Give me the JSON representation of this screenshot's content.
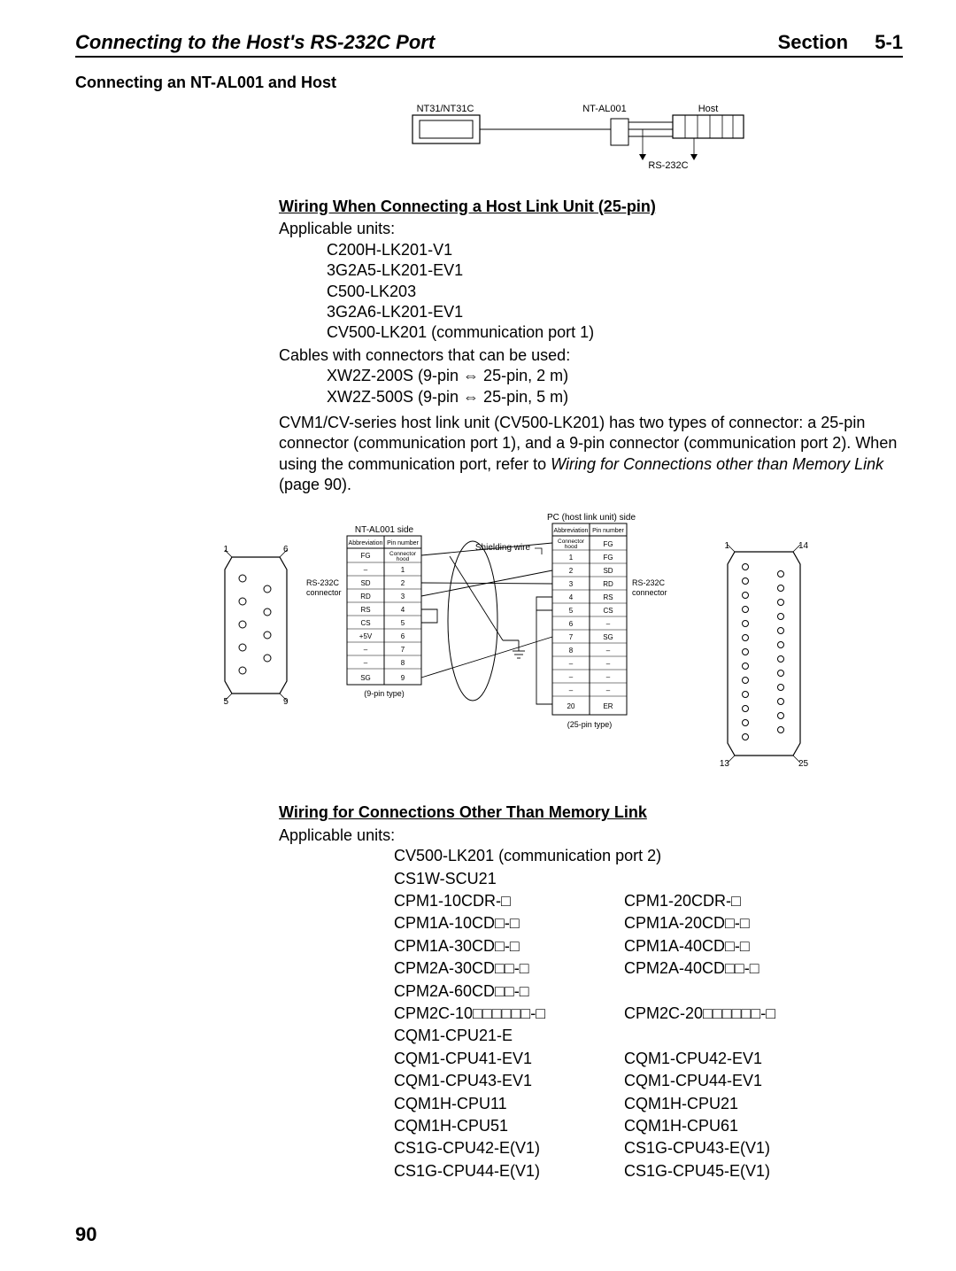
{
  "header": {
    "left": "Connecting to the Host's RS-232C Port",
    "right_label": "Section",
    "right_num": "5-1"
  },
  "sec": {
    "title": "Connecting an NT-AL001 and Host"
  },
  "top_diagram": {
    "left_label": "NT31/NT31C",
    "mid_label": "NT-AL001",
    "right_label": "Host",
    "rs232c_label": "RS-232C"
  },
  "wiring25": {
    "heading": "Wiring When Connecting a Host Link Unit (25-pin)",
    "applicable": "Applicable units:",
    "units": [
      "C200H-LK201-V1",
      "3G2A5-LK201-EV1",
      "C500-LK203",
      "3G2A6-LK201-EV1",
      "CV500-LK201 (communication port 1)"
    ],
    "cables_label": "Cables with connectors that can be used:",
    "cables": [
      "XW2Z-200S (9-pin ⇔ 25-pin, 2 m)",
      "XW2Z-500S (9-pin ⇔ 25-pin, 5 m)"
    ],
    "note": "CVM1/CV-series host link unit (CV500-LK201) has two types of connector: a 25-pin connector (communication port 1), and a 9-pin connector (communication port 2). When using the communication port, refer to ",
    "note_italic": "Wiring for Connections other than Memory Link",
    "note_tail": " (page 90)."
  },
  "wiring_diagram": {
    "nt_side_label": "NT-AL001 side",
    "pc_side_label": "PC (host link unit) side",
    "col_abbrev": "Abbreviation",
    "col_pin": "Pin number",
    "shield_label": "Shielding wire",
    "rs232c_conn": "RS-232C\nconnector",
    "nine_pin_label": "(9-pin type)",
    "twentyfive_pin_label": "(25-pin type)",
    "left_numbers": {
      "tl": "1",
      "tr": "6",
      "bl": "5",
      "br": "9"
    },
    "right_numbers": {
      "tl": "1",
      "tr": "14",
      "bl": "13",
      "br": "25"
    },
    "left_table": [
      {
        "abbr": "FG",
        "pin": "Connector hood"
      },
      {
        "abbr": "–",
        "pin": "1"
      },
      {
        "abbr": "SD",
        "pin": "2"
      },
      {
        "abbr": "RD",
        "pin": "3"
      },
      {
        "abbr": "RS",
        "pin": "4"
      },
      {
        "abbr": "CS",
        "pin": "5"
      },
      {
        "abbr": "+5V",
        "pin": "6"
      },
      {
        "abbr": "–",
        "pin": "7"
      },
      {
        "abbr": "–",
        "pin": "8"
      },
      {
        "abbr": "SG",
        "pin": "9"
      }
    ],
    "right_table": [
      {
        "abbr": "Connector hood",
        "pin": "FG"
      },
      {
        "abbr": "1",
        "pin": "FG"
      },
      {
        "abbr": "2",
        "pin": "SD"
      },
      {
        "abbr": "3",
        "pin": "RD"
      },
      {
        "abbr": "4",
        "pin": "RS"
      },
      {
        "abbr": "5",
        "pin": "CS"
      },
      {
        "abbr": "6",
        "pin": "–"
      },
      {
        "abbr": "7",
        "pin": "SG"
      },
      {
        "abbr": "8",
        "pin": "–"
      },
      {
        "abbr": "–",
        "pin": "–"
      },
      {
        "abbr": "–",
        "pin": "–"
      },
      {
        "abbr": "–",
        "pin": "–"
      },
      {
        "abbr": "20",
        "pin": "ER"
      }
    ]
  },
  "other": {
    "heading": "Wiring for Connections Other Than Memory Link",
    "applicable": "Applicable units:",
    "rows": [
      {
        "a": "CV500-LK201 (communication port 2)",
        "b": ""
      },
      {
        "a": "CS1W-SCU21",
        "b": ""
      },
      {
        "a": "CPM1-10CDR-□",
        "b": "CPM1-20CDR-□"
      },
      {
        "a": "CPM1A-10CD□-□",
        "b": "CPM1A-20CD□-□"
      },
      {
        "a": "CPM1A-30CD□-□",
        "b": "CPM1A-40CD□-□"
      },
      {
        "a": "CPM2A-30CD□□-□",
        "b": "CPM2A-40CD□□-□"
      },
      {
        "a": "CPM2A-60CD□□-□",
        "b": ""
      },
      {
        "a": "CPM2C-10□□□□□□-□",
        "b": "CPM2C-20□□□□□□-□"
      },
      {
        "a": "CQM1-CPU21-E",
        "b": ""
      },
      {
        "a": "CQM1-CPU41-EV1",
        "b": "CQM1-CPU42-EV1"
      },
      {
        "a": "CQM1-CPU43-EV1",
        "b": "CQM1-CPU44-EV1"
      },
      {
        "a": "CQM1H-CPU11",
        "b": "CQM1H-CPU21"
      },
      {
        "a": "CQM1H-CPU51",
        "b": "CQM1H-CPU61"
      },
      {
        "a": "CS1G-CPU42-E(V1)",
        "b": "CS1G-CPU43-E(V1)"
      },
      {
        "a": "CS1G-CPU44-E(V1)",
        "b": "CS1G-CPU45-E(V1)"
      }
    ]
  },
  "page_number": "90"
}
